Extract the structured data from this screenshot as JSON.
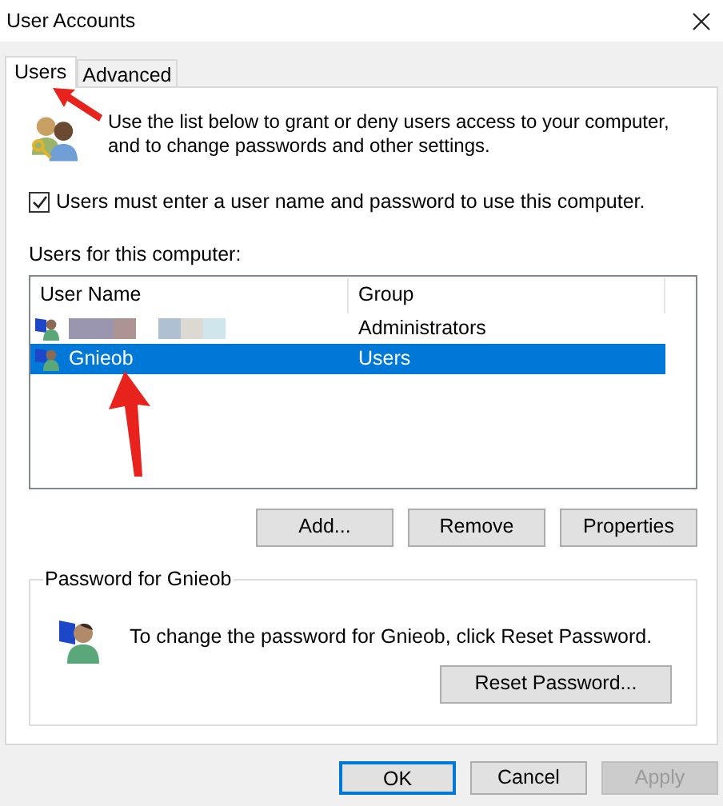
{
  "window": {
    "title": "User Accounts"
  },
  "tabs": [
    {
      "label": "Users",
      "selected": true
    },
    {
      "label": "Advanced",
      "selected": false
    }
  ],
  "intro": "Use the list below to grant or deny users access to your computer, and to change passwords and other settings.",
  "require_login": {
    "label": "Users must enter a user name and password to use this computer.",
    "checked": true
  },
  "users_label": "Users for this computer:",
  "table": {
    "columns": [
      "User Name",
      "Group"
    ],
    "rows": [
      {
        "kind": "redacted",
        "group": "Administrators",
        "selected": false
      },
      {
        "kind": "text",
        "name": "Gnieob",
        "group": "Users",
        "selected": true
      }
    ]
  },
  "list_buttons": [
    "Add...",
    "Remove",
    "Properties"
  ],
  "password_group": {
    "title": "Password for Gnieob",
    "text": "To change the password for Gnieob, click Reset Password.",
    "button": "Reset Password..."
  },
  "dialog_buttons": [
    {
      "label": "OK",
      "kind": "default",
      "disabled": false
    },
    {
      "label": "Cancel",
      "kind": "normal",
      "disabled": false
    },
    {
      "label": "Apply",
      "kind": "normal",
      "disabled": true
    }
  ]
}
